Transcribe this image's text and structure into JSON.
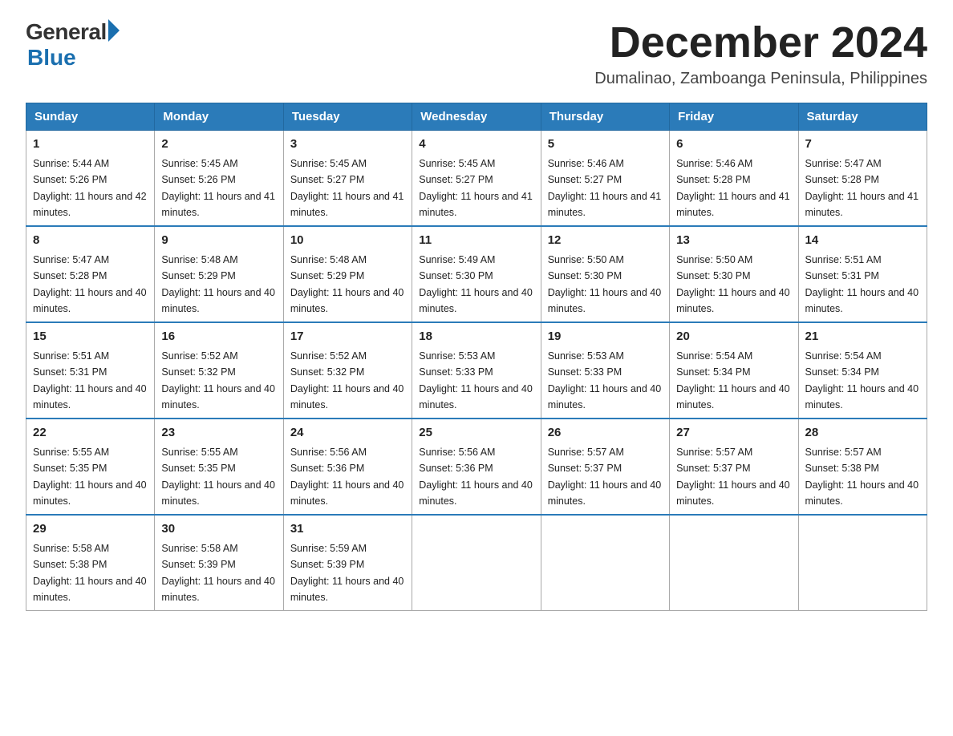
{
  "logo": {
    "general": "General",
    "blue": "Blue"
  },
  "title": "December 2024",
  "location": "Dumalinao, Zamboanga Peninsula, Philippines",
  "days_of_week": [
    "Sunday",
    "Monday",
    "Tuesday",
    "Wednesday",
    "Thursday",
    "Friday",
    "Saturday"
  ],
  "weeks": [
    [
      {
        "day": "1",
        "sunrise": "5:44 AM",
        "sunset": "5:26 PM",
        "daylight": "11 hours and 42 minutes."
      },
      {
        "day": "2",
        "sunrise": "5:45 AM",
        "sunset": "5:26 PM",
        "daylight": "11 hours and 41 minutes."
      },
      {
        "day": "3",
        "sunrise": "5:45 AM",
        "sunset": "5:27 PM",
        "daylight": "11 hours and 41 minutes."
      },
      {
        "day": "4",
        "sunrise": "5:45 AM",
        "sunset": "5:27 PM",
        "daylight": "11 hours and 41 minutes."
      },
      {
        "day": "5",
        "sunrise": "5:46 AM",
        "sunset": "5:27 PM",
        "daylight": "11 hours and 41 minutes."
      },
      {
        "day": "6",
        "sunrise": "5:46 AM",
        "sunset": "5:28 PM",
        "daylight": "11 hours and 41 minutes."
      },
      {
        "day": "7",
        "sunrise": "5:47 AM",
        "sunset": "5:28 PM",
        "daylight": "11 hours and 41 minutes."
      }
    ],
    [
      {
        "day": "8",
        "sunrise": "5:47 AM",
        "sunset": "5:28 PM",
        "daylight": "11 hours and 40 minutes."
      },
      {
        "day": "9",
        "sunrise": "5:48 AM",
        "sunset": "5:29 PM",
        "daylight": "11 hours and 40 minutes."
      },
      {
        "day": "10",
        "sunrise": "5:48 AM",
        "sunset": "5:29 PM",
        "daylight": "11 hours and 40 minutes."
      },
      {
        "day": "11",
        "sunrise": "5:49 AM",
        "sunset": "5:30 PM",
        "daylight": "11 hours and 40 minutes."
      },
      {
        "day": "12",
        "sunrise": "5:50 AM",
        "sunset": "5:30 PM",
        "daylight": "11 hours and 40 minutes."
      },
      {
        "day": "13",
        "sunrise": "5:50 AM",
        "sunset": "5:30 PM",
        "daylight": "11 hours and 40 minutes."
      },
      {
        "day": "14",
        "sunrise": "5:51 AM",
        "sunset": "5:31 PM",
        "daylight": "11 hours and 40 minutes."
      }
    ],
    [
      {
        "day": "15",
        "sunrise": "5:51 AM",
        "sunset": "5:31 PM",
        "daylight": "11 hours and 40 minutes."
      },
      {
        "day": "16",
        "sunrise": "5:52 AM",
        "sunset": "5:32 PM",
        "daylight": "11 hours and 40 minutes."
      },
      {
        "day": "17",
        "sunrise": "5:52 AM",
        "sunset": "5:32 PM",
        "daylight": "11 hours and 40 minutes."
      },
      {
        "day": "18",
        "sunrise": "5:53 AM",
        "sunset": "5:33 PM",
        "daylight": "11 hours and 40 minutes."
      },
      {
        "day": "19",
        "sunrise": "5:53 AM",
        "sunset": "5:33 PM",
        "daylight": "11 hours and 40 minutes."
      },
      {
        "day": "20",
        "sunrise": "5:54 AM",
        "sunset": "5:34 PM",
        "daylight": "11 hours and 40 minutes."
      },
      {
        "day": "21",
        "sunrise": "5:54 AM",
        "sunset": "5:34 PM",
        "daylight": "11 hours and 40 minutes."
      }
    ],
    [
      {
        "day": "22",
        "sunrise": "5:55 AM",
        "sunset": "5:35 PM",
        "daylight": "11 hours and 40 minutes."
      },
      {
        "day": "23",
        "sunrise": "5:55 AM",
        "sunset": "5:35 PM",
        "daylight": "11 hours and 40 minutes."
      },
      {
        "day": "24",
        "sunrise": "5:56 AM",
        "sunset": "5:36 PM",
        "daylight": "11 hours and 40 minutes."
      },
      {
        "day": "25",
        "sunrise": "5:56 AM",
        "sunset": "5:36 PM",
        "daylight": "11 hours and 40 minutes."
      },
      {
        "day": "26",
        "sunrise": "5:57 AM",
        "sunset": "5:37 PM",
        "daylight": "11 hours and 40 minutes."
      },
      {
        "day": "27",
        "sunrise": "5:57 AM",
        "sunset": "5:37 PM",
        "daylight": "11 hours and 40 minutes."
      },
      {
        "day": "28",
        "sunrise": "5:57 AM",
        "sunset": "5:38 PM",
        "daylight": "11 hours and 40 minutes."
      }
    ],
    [
      {
        "day": "29",
        "sunrise": "5:58 AM",
        "sunset": "5:38 PM",
        "daylight": "11 hours and 40 minutes."
      },
      {
        "day": "30",
        "sunrise": "5:58 AM",
        "sunset": "5:39 PM",
        "daylight": "11 hours and 40 minutes."
      },
      {
        "day": "31",
        "sunrise": "5:59 AM",
        "sunset": "5:39 PM",
        "daylight": "11 hours and 40 minutes."
      },
      null,
      null,
      null,
      null
    ]
  ]
}
